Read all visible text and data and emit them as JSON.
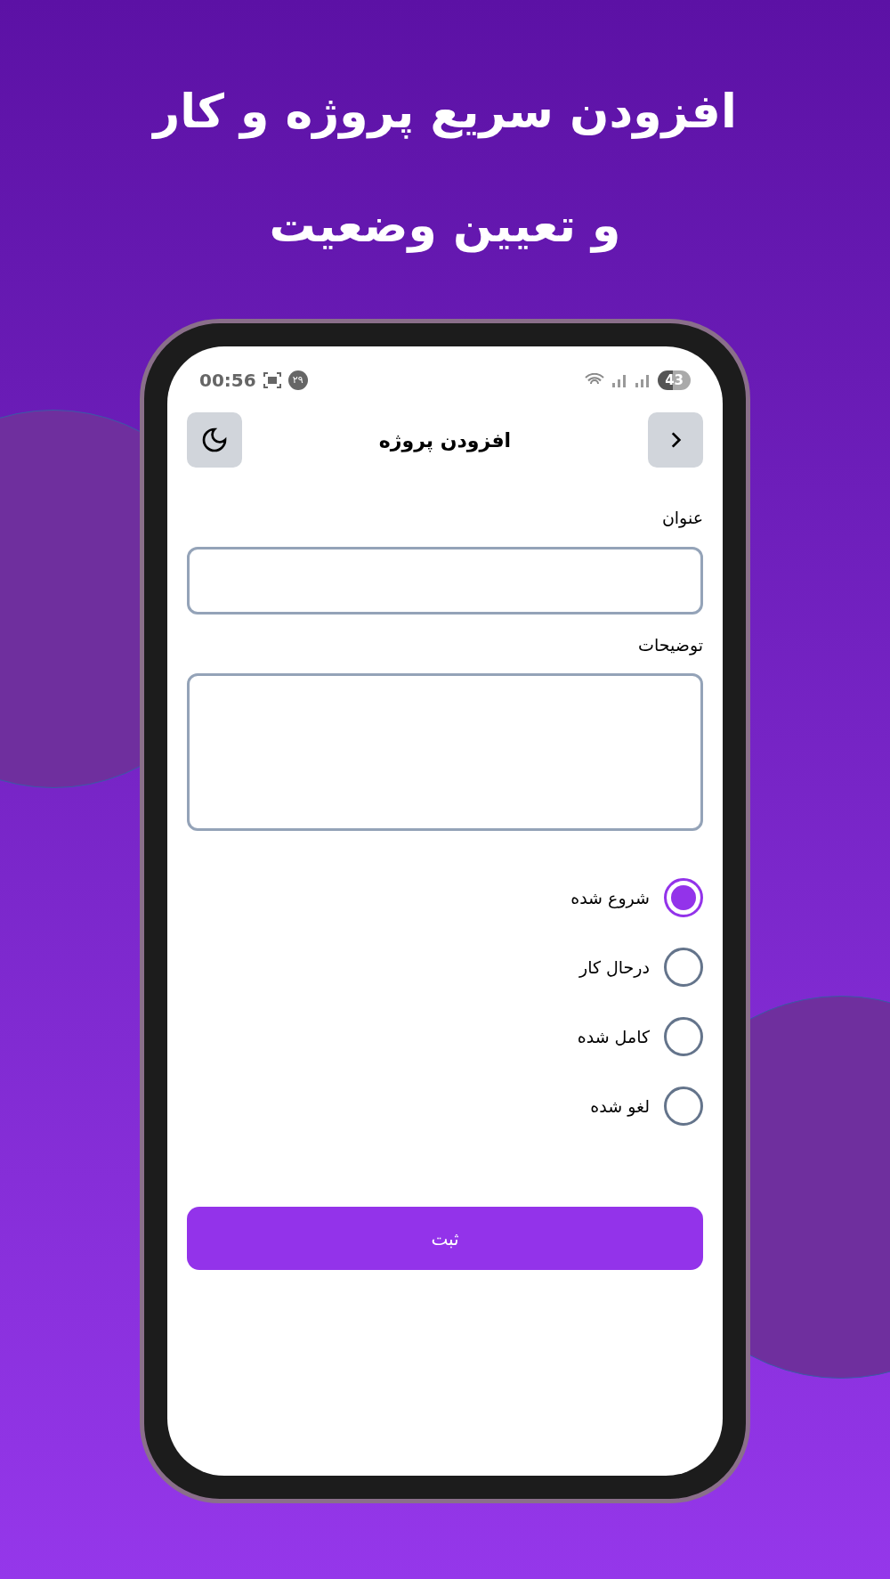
{
  "headline": [
    "افزودن سریع پروژه و کار",
    "و تعیین وضعیت"
  ],
  "status_bar": {
    "time": "00:56",
    "notification_badge": "۲۹",
    "battery": "43"
  },
  "header": {
    "title": "افزودن پروژه"
  },
  "form": {
    "fields": [
      {
        "label": "عنوان",
        "kind": "input"
      },
      {
        "label": "توضیحات",
        "kind": "textarea"
      }
    ],
    "status_options": [
      {
        "label": "شروع شده",
        "selected": true
      },
      {
        "label": "درحال کار",
        "selected": false
      },
      {
        "label": "کامل شده",
        "selected": false
      },
      {
        "label": "لغو شده",
        "selected": false
      }
    ],
    "submit": "ثبت"
  }
}
